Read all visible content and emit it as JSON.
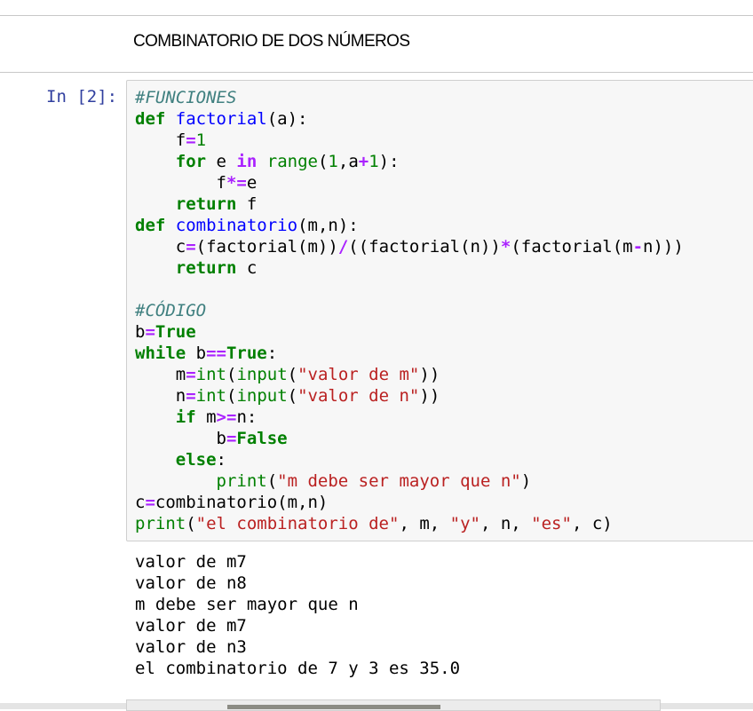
{
  "markdown_heading": "COMBINATORIO DE DOS NÚMEROS",
  "cell": {
    "prompt": "In [2]:",
    "code_lines": [
      [
        [
          "c",
          "#FUNCIONES"
        ]
      ],
      [
        [
          "k",
          "def"
        ],
        [
          "p",
          " "
        ],
        [
          "f",
          "factorial"
        ],
        [
          "p",
          "(a):"
        ]
      ],
      [
        [
          "p",
          "    f"
        ],
        [
          "o",
          "="
        ],
        [
          "n",
          "1"
        ]
      ],
      [
        [
          "p",
          "    "
        ],
        [
          "k",
          "for"
        ],
        [
          "p",
          " e "
        ],
        [
          "o",
          "in"
        ],
        [
          "p",
          " "
        ],
        [
          "b",
          "range"
        ],
        [
          "p",
          "("
        ],
        [
          "n",
          "1"
        ],
        [
          "p",
          ",a"
        ],
        [
          "o",
          "+"
        ],
        [
          "n",
          "1"
        ],
        [
          "p",
          "):"
        ]
      ],
      [
        [
          "p",
          "        f"
        ],
        [
          "o",
          "*="
        ],
        [
          "p",
          "e"
        ]
      ],
      [
        [
          "p",
          "    "
        ],
        [
          "k",
          "return"
        ],
        [
          "p",
          " f"
        ]
      ],
      [
        [
          "k",
          "def"
        ],
        [
          "p",
          " "
        ],
        [
          "f",
          "combinatorio"
        ],
        [
          "p",
          "(m,n):"
        ]
      ],
      [
        [
          "p",
          "    c"
        ],
        [
          "o",
          "="
        ],
        [
          "p",
          "(factorial(m))"
        ],
        [
          "o",
          "/"
        ],
        [
          "p",
          "((factorial(n))"
        ],
        [
          "o",
          "*"
        ],
        [
          "p",
          "(factorial(m"
        ],
        [
          "o",
          "-"
        ],
        [
          "p",
          "n)))"
        ]
      ],
      [
        [
          "p",
          "    "
        ],
        [
          "k",
          "return"
        ],
        [
          "p",
          " c"
        ]
      ],
      [
        [
          "p",
          ""
        ]
      ],
      [
        [
          "c",
          "#CÓDIGO"
        ]
      ],
      [
        [
          "p",
          "b"
        ],
        [
          "o",
          "="
        ],
        [
          "k",
          "True"
        ]
      ],
      [
        [
          "k",
          "while"
        ],
        [
          "p",
          " b"
        ],
        [
          "o",
          "=="
        ],
        [
          "k",
          "True"
        ],
        [
          "p",
          ":"
        ]
      ],
      [
        [
          "p",
          "    m"
        ],
        [
          "o",
          "="
        ],
        [
          "b",
          "int"
        ],
        [
          "p",
          "("
        ],
        [
          "b",
          "input"
        ],
        [
          "p",
          "("
        ],
        [
          "s",
          "\"valor de m\""
        ],
        [
          "p",
          "))"
        ]
      ],
      [
        [
          "p",
          "    n"
        ],
        [
          "o",
          "="
        ],
        [
          "b",
          "int"
        ],
        [
          "p",
          "("
        ],
        [
          "b",
          "input"
        ],
        [
          "p",
          "("
        ],
        [
          "s",
          "\"valor de n\""
        ],
        [
          "p",
          "))"
        ]
      ],
      [
        [
          "p",
          "    "
        ],
        [
          "k",
          "if"
        ],
        [
          "p",
          " m"
        ],
        [
          "o",
          ">="
        ],
        [
          "p",
          "n:"
        ]
      ],
      [
        [
          "p",
          "        b"
        ],
        [
          "o",
          "="
        ],
        [
          "k",
          "False"
        ]
      ],
      [
        [
          "p",
          "    "
        ],
        [
          "k",
          "else"
        ],
        [
          "p",
          ":"
        ]
      ],
      [
        [
          "p",
          "        "
        ],
        [
          "b",
          "print"
        ],
        [
          "p",
          "("
        ],
        [
          "s",
          "\"m debe ser mayor que n\""
        ],
        [
          "p",
          ")"
        ]
      ],
      [
        [
          "p",
          "c"
        ],
        [
          "o",
          "="
        ],
        [
          "p",
          "combinatorio(m,n)"
        ]
      ],
      [
        [
          "b",
          "print"
        ],
        [
          "p",
          "("
        ],
        [
          "s",
          "\"el combinatorio de\""
        ],
        [
          "p",
          ", m, "
        ],
        [
          "s",
          "\"y\""
        ],
        [
          "p",
          ", n, "
        ],
        [
          "s",
          "\"es\""
        ],
        [
          "p",
          ", c)"
        ]
      ]
    ],
    "output_lines": [
      "valor de m7",
      "valor de n8",
      "m debe ser mayor que n",
      "valor de m7",
      "valor de n3",
      "el combinatorio de 7 y 3 es 35.0"
    ]
  }
}
